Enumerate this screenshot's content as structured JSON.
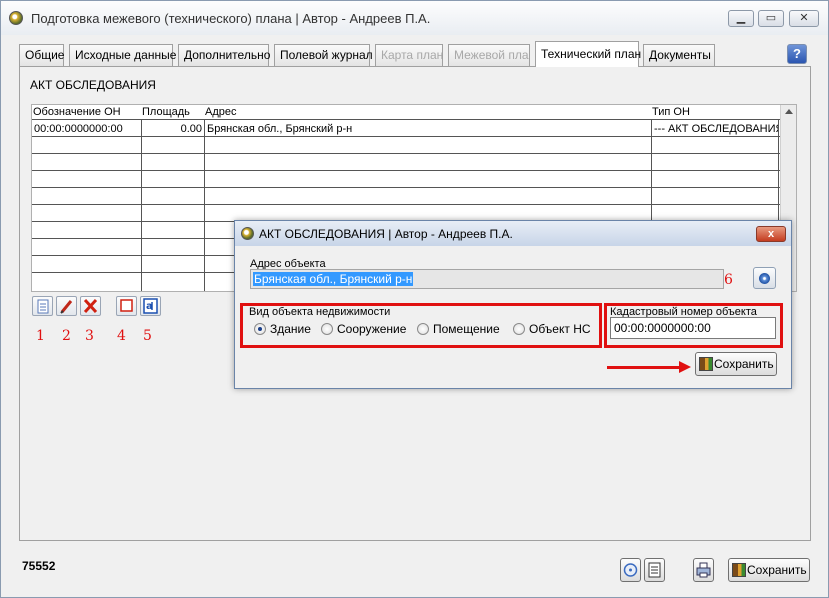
{
  "window": {
    "title": "Подготовка межевого (технического) плана | Автор - Андреев П.А.",
    "minimize": "▁",
    "maximize": "▭",
    "close": "✕"
  },
  "tabs": [
    {
      "label": "Общие",
      "state": "normal"
    },
    {
      "label": "Исходные данные",
      "state": "normal"
    },
    {
      "label": "Дополнительно",
      "state": "normal"
    },
    {
      "label": "Полевой журнал",
      "state": "normal"
    },
    {
      "label": "Карта план",
      "state": "disabled"
    },
    {
      "label": "Межевой план",
      "state": "disabled"
    },
    {
      "label": "Технический план",
      "state": "active"
    },
    {
      "label": "Документы",
      "state": "normal"
    }
  ],
  "help_label": "?",
  "section_title": "АКТ ОБСЛЕДОВАНИЯ",
  "table": {
    "columns": [
      "Обозначение ОН",
      "Площадь",
      "Адрес",
      "Тип ОН"
    ],
    "rows": [
      {
        "id": "00:00:0000000:00",
        "area": "0.00",
        "address": "Брянская обл., Брянский р-н",
        "type": "--- АКТ ОБСЛЕДОВАНИЯ ---"
      }
    ]
  },
  "toolbar": {
    "icons": [
      "document-icon",
      "pencil-icon",
      "delete-icon",
      "square-icon",
      "report-icon"
    ],
    "numbers": [
      "1",
      "2",
      "3",
      "4",
      "5"
    ]
  },
  "status_code": "75552",
  "bottom_save_label": "Сохранить",
  "dialog": {
    "title": "АКТ ОБСЛЕДОВАНИЯ | Автор - Андреев П.А.",
    "close": "x",
    "address_label": "Адрес объекта",
    "address_value": "Брянская обл., Брянский р-н",
    "annotation_6": "6",
    "property_type_label": "Вид объекта недвижимости",
    "property_types": [
      {
        "label": "Здание",
        "selected": true
      },
      {
        "label": "Сооружение",
        "selected": false
      },
      {
        "label": "Помещение",
        "selected": false
      },
      {
        "label": "Объект НС",
        "selected": false
      }
    ],
    "cadastral_label": "Кадастровый номер объекта",
    "cadastral_value": "00:00:0000000:00",
    "save_label": "Сохранить"
  },
  "colors": {
    "annotation_red": "#e01010",
    "selection_blue": "#3399ff"
  }
}
